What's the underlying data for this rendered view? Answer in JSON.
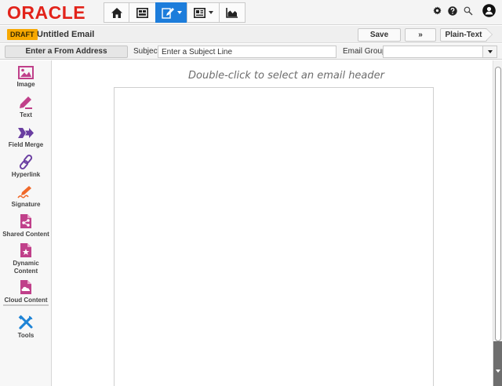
{
  "brand": {
    "logo_text": "ORACLE",
    "logo_color": "#e2231a",
    "accent": "#1d7ddb"
  },
  "nav": {
    "buttons": [
      {
        "icon": "home-icon"
      },
      {
        "icon": "dashboard-icon"
      },
      {
        "icon": "edit-icon",
        "active": true,
        "dropdown": true
      },
      {
        "icon": "layout-icon",
        "dropdown": true
      },
      {
        "icon": "chart-icon"
      }
    ]
  },
  "top_right": {
    "icons": [
      "settings-icon",
      "help-icon",
      "search-icon",
      "user-icon"
    ]
  },
  "title_bar": {
    "status_badge": "DRAFT",
    "badge_color": "#f7a800",
    "document_title": "Untitled Email",
    "save_label": "Save",
    "more_label": "»",
    "plain_text_label": "Plain-Text"
  },
  "header_fields": {
    "from_button": "Enter a From Address",
    "subject_label": "Subject:",
    "subject_placeholder": "Enter a Subject Line",
    "email_group_label": "Email Group:",
    "email_group_value": ""
  },
  "palette": {
    "items": [
      {
        "label": "Image",
        "icon": "image-icon"
      },
      {
        "label": "Text",
        "icon": "pencil-icon"
      },
      {
        "label": "Field Merge",
        "icon": "merge-arrow-icon"
      },
      {
        "label": "Hyperlink",
        "icon": "link-icon"
      },
      {
        "label": "Signature",
        "icon": "signature-pen-icon"
      },
      {
        "label": "Shared Content",
        "icon": "shared-document-icon"
      },
      {
        "label": "Dynamic Content",
        "label_line1": "Dynamic",
        "label_line2": "Content",
        "icon": "star-document-icon"
      },
      {
        "label": "Cloud Content",
        "icon": "cloud-document-icon"
      },
      {
        "label": "Tools",
        "icon": "tools-icon"
      }
    ]
  },
  "canvas": {
    "hint": "Double-click to select an email header"
  }
}
